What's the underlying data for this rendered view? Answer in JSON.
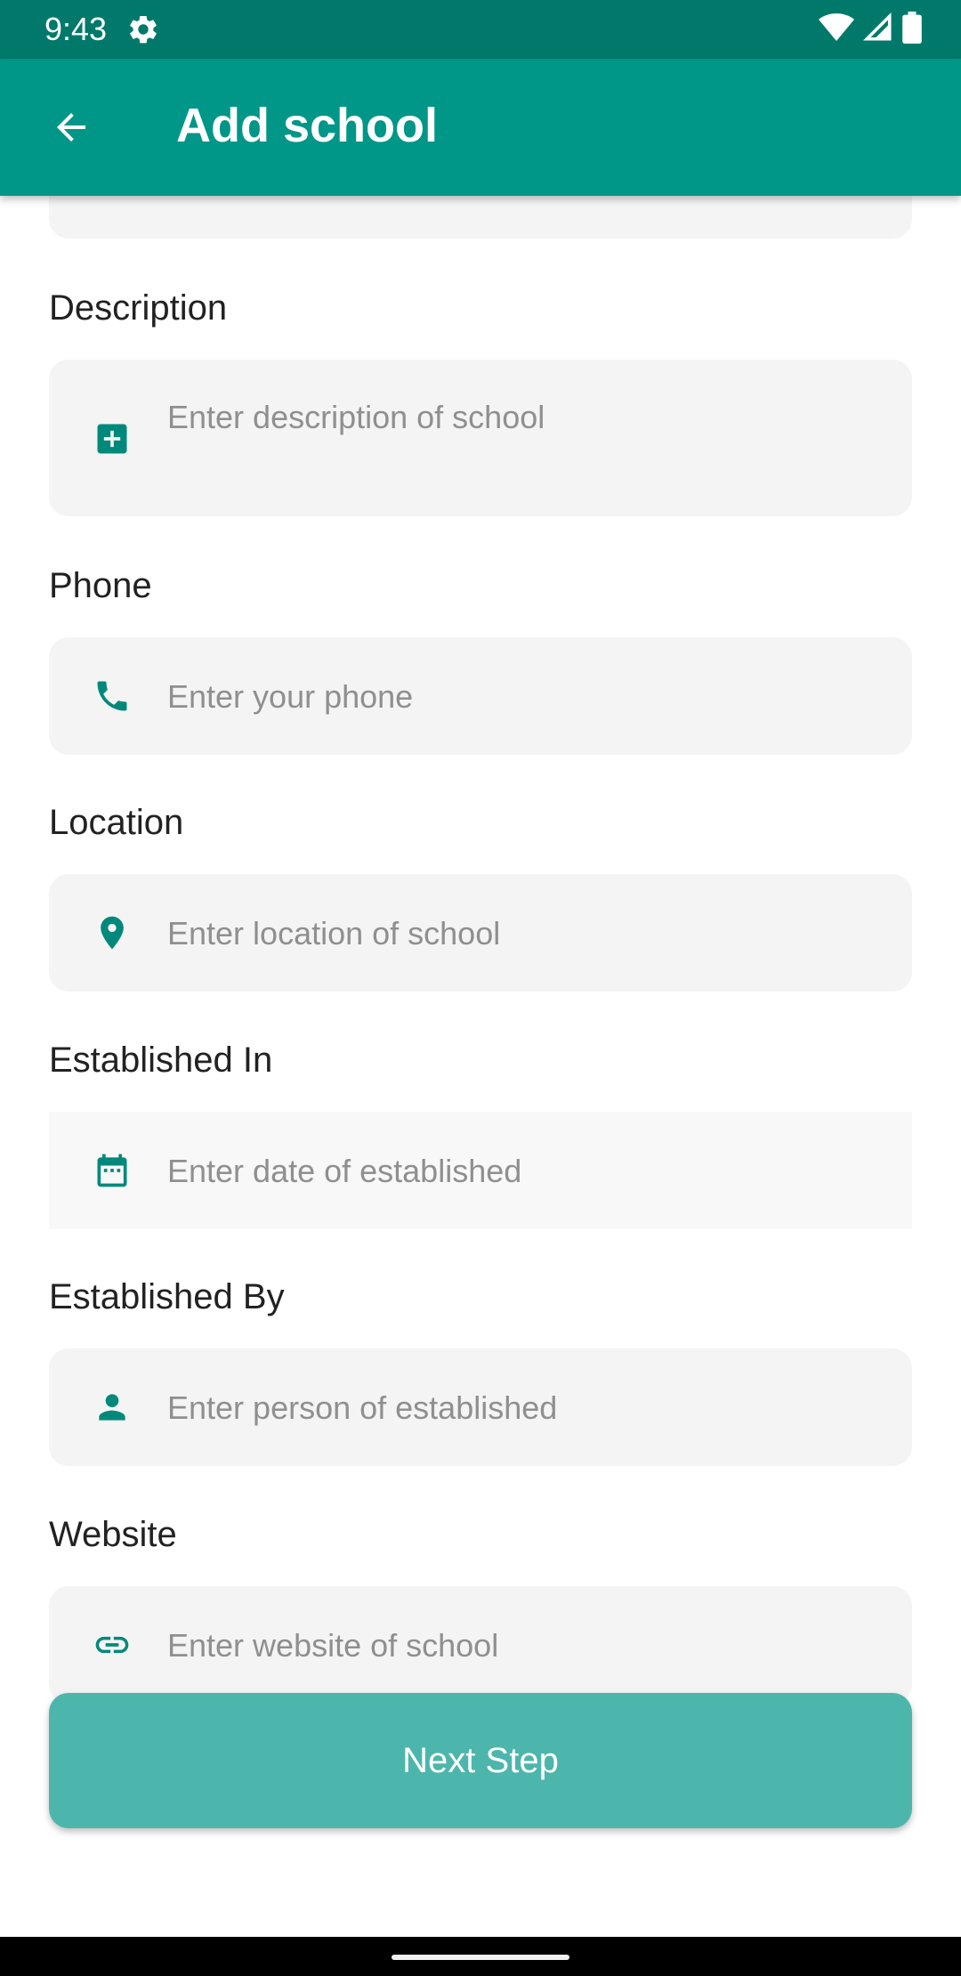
{
  "status": {
    "time": "9:43"
  },
  "appbar": {
    "title": "Add school"
  },
  "fields": {
    "description": {
      "label": "Description",
      "placeholder": "Enter description of school"
    },
    "phone": {
      "label": "Phone",
      "placeholder": "Enter your phone"
    },
    "location": {
      "label": "Location",
      "placeholder": "Enter location of school"
    },
    "established_in": {
      "label": "Established In",
      "placeholder": "Enter date of established"
    },
    "established_by": {
      "label": "Established By",
      "placeholder": "Enter person of established"
    },
    "website": {
      "label": "Website",
      "placeholder": "Enter website of school"
    }
  },
  "actions": {
    "next_label": "Next Step"
  },
  "colors": {
    "primary": "#009688",
    "primary_dark": "#00796b",
    "button": "#4db6ac",
    "field_bg": "#f4f4f4"
  }
}
